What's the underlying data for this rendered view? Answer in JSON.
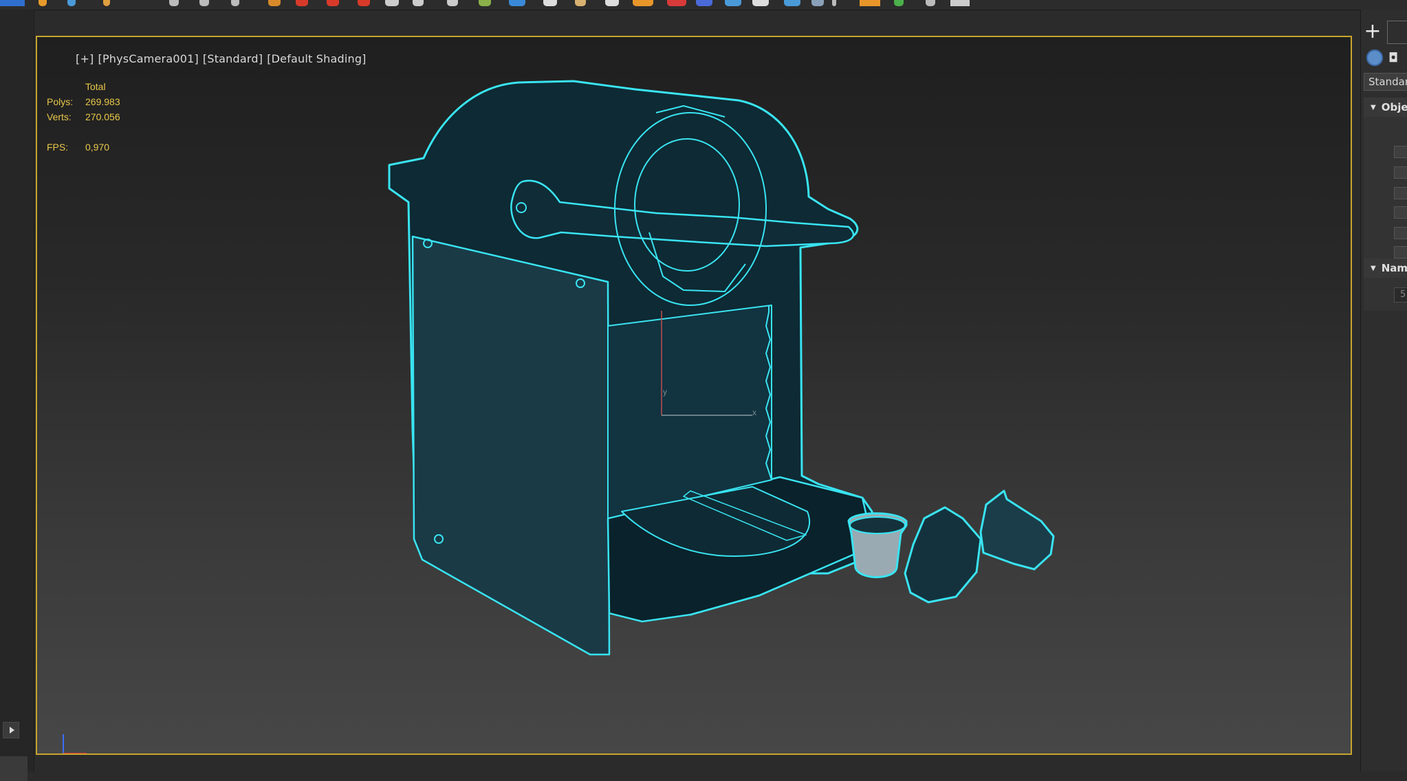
{
  "viewport": {
    "label_parts": [
      "[+]",
      "[PhysCamera001]",
      "[Standard]",
      "[Default Shading]"
    ],
    "stats": {
      "header": "Total",
      "polys_label": "Polys:",
      "polys_value": "269.983",
      "verts_label": "Verts:",
      "verts_value": "270.056",
      "fps_label": "FPS:",
      "fps_value": "0,970"
    },
    "gizmo_axis_x": "x",
    "gizmo_axis_y": "y",
    "accent_color": "#c8a52c",
    "selection_color": "#39e4f2"
  },
  "command_panel": {
    "create_icon": "plus-icon",
    "object_type_dropdown": "Standard",
    "object_type_rollout": "Object Type",
    "name_color_rollout": "Name and Color",
    "name_field_value": "5"
  }
}
